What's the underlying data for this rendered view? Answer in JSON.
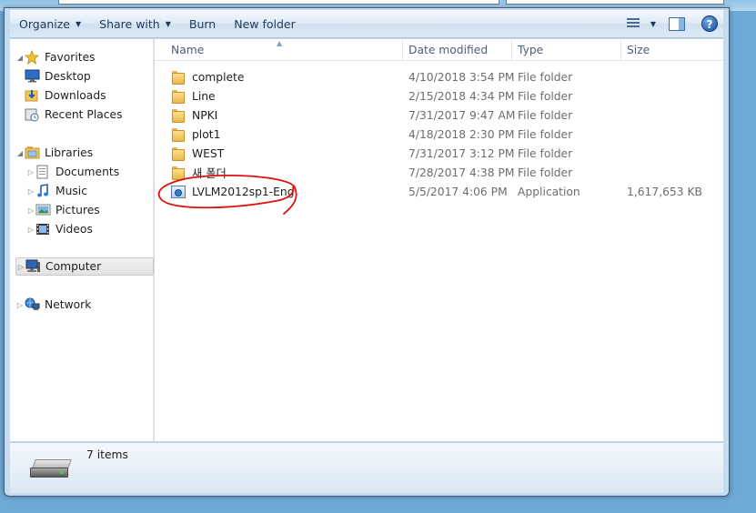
{
  "toolbar": {
    "organize": "Organize",
    "share_with": "Share with",
    "burn": "Burn",
    "new_folder": "New folder",
    "help": "?"
  },
  "nav": {
    "favorites": "Favorites",
    "desktop": "Desktop",
    "downloads": "Downloads",
    "recent_places": "Recent Places",
    "libraries": "Libraries",
    "documents": "Documents",
    "music": "Music",
    "pictures": "Pictures",
    "videos": "Videos",
    "computer": "Computer",
    "network": "Network"
  },
  "columns": {
    "name": "Name",
    "date_modified": "Date modified",
    "type": "Type",
    "size": "Size"
  },
  "files": [
    {
      "name": "complete",
      "date": "4/10/2018 3:54 PM",
      "type": "File folder",
      "size": ""
    },
    {
      "name": "Line",
      "date": "2/15/2018 4:34 PM",
      "type": "File folder",
      "size": ""
    },
    {
      "name": "NPKI",
      "date": "7/31/2017 9:47 AM",
      "type": "File folder",
      "size": ""
    },
    {
      "name": "plot1",
      "date": "4/18/2018 2:30 PM",
      "type": "File folder",
      "size": ""
    },
    {
      "name": "WEST",
      "date": "7/31/2017 3:12 PM",
      "type": "File folder",
      "size": ""
    },
    {
      "name": "새 폴더",
      "date": "7/28/2017 4:38 PM",
      "type": "File folder",
      "size": ""
    },
    {
      "name": "LVLM2012sp1-Eng",
      "date": "5/5/2017 4:06 PM",
      "type": "Application",
      "size": "1,617,653 KB"
    }
  ],
  "status": {
    "items_count": "7 items"
  },
  "colors": {
    "annotation": "#e01010",
    "selection_bg": "#e2e2e2"
  }
}
